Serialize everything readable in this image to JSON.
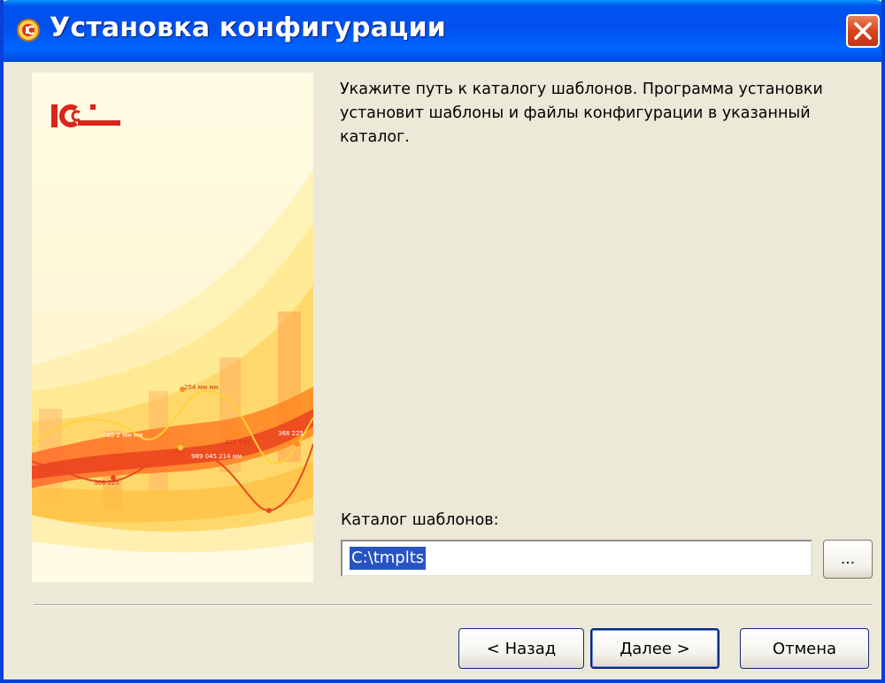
{
  "window": {
    "title": "Установка конфигурации",
    "title_icon": "1c-app-icon",
    "close_icon": "close-icon"
  },
  "banner": {
    "logo_text": "1С",
    "chart_labels": [
      "254 мм мм",
      "065 2 мм мм",
      "989 045 214 мм",
      "211 532",
      "368 225",
      "368 225"
    ]
  },
  "content": {
    "description": "Укажите путь к каталогу шаблонов. Программа установки установит шаблоны и файлы конфигурации в указанный каталог.",
    "folder_label": "Каталог шаблонов:",
    "folder_value": "C:\\tmplts",
    "browse_label": "..."
  },
  "buttons": {
    "back": "< Назад",
    "next": "Далее >",
    "cancel": "Отмена"
  },
  "colors": {
    "titlebar": "#0050ee",
    "window_bg": "#ece9d8",
    "selection": "#2654c3",
    "close": "#d8441b"
  }
}
